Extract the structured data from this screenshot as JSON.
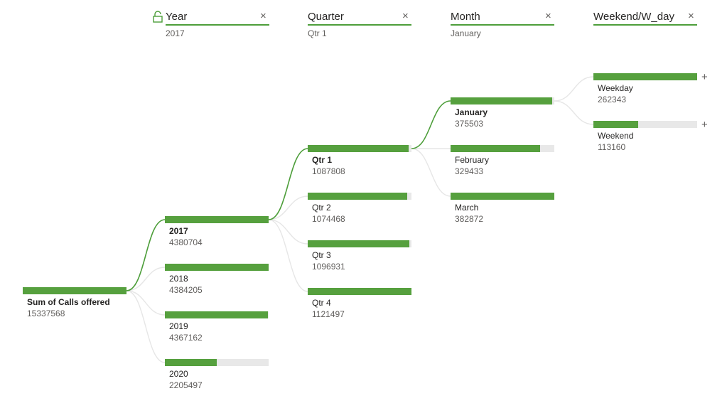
{
  "colors": {
    "bar": "#56a03e",
    "track": "#e8e8e8",
    "link_active": "#4d9e3a",
    "link_inactive": "#e6e6e6",
    "underline": "#4d9e3a"
  },
  "levels": [
    {
      "title": "Year",
      "selection": "2017",
      "locked": true
    },
    {
      "title": "Quarter",
      "selection": "Qtr 1",
      "locked": false
    },
    {
      "title": "Month",
      "selection": "January",
      "locked": false
    },
    {
      "title": "Weekend/W_day",
      "selection": "",
      "locked": false
    }
  ],
  "root": {
    "label": "Sum of Calls offered",
    "value": "15337568",
    "fill": 1.0
  },
  "year_nodes": [
    {
      "label": "2017",
      "value": "4380704",
      "fill": 0.999,
      "selected": true
    },
    {
      "label": "2018",
      "value": "4384205",
      "fill": 1.0,
      "selected": false
    },
    {
      "label": "2019",
      "value": "4367162",
      "fill": 0.996,
      "selected": false
    },
    {
      "label": "2020",
      "value": "2205497",
      "fill": 0.503,
      "selected": false
    }
  ],
  "quarter_nodes": [
    {
      "label": "Qtr 1",
      "value": "1087808",
      "fill": 0.97,
      "selected": true
    },
    {
      "label": "Qtr 2",
      "value": "1074468",
      "fill": 0.958,
      "selected": false
    },
    {
      "label": "Qtr 3",
      "value": "1096931",
      "fill": 0.978,
      "selected": false
    },
    {
      "label": "Qtr 4",
      "value": "1121497",
      "fill": 1.0,
      "selected": false
    }
  ],
  "month_nodes": [
    {
      "label": "January",
      "value": "375503",
      "fill": 0.981,
      "selected": true
    },
    {
      "label": "February",
      "value": "329433",
      "fill": 0.86,
      "selected": false
    },
    {
      "label": "March",
      "value": "382872",
      "fill": 1.0,
      "selected": false
    }
  ],
  "daytype_nodes": [
    {
      "label": "Weekday",
      "value": "262343",
      "fill": 1.0,
      "selected": false,
      "expand": "+"
    },
    {
      "label": "Weekend",
      "value": "113160",
      "fill": 0.431,
      "selected": false,
      "expand": "+"
    }
  ],
  "close_glyph": "×"
}
